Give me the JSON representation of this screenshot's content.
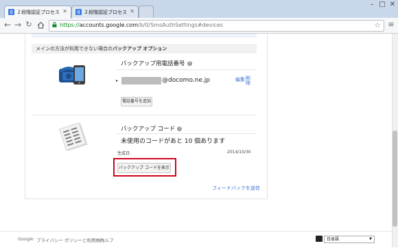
{
  "browser": {
    "tabs": [
      {
        "label": "２段階認証プロセス",
        "fav": "g"
      },
      {
        "label": "２段階認証プロセス",
        "fav": "g"
      }
    ],
    "url": {
      "scheme": "https://",
      "host": "accounts.google.com",
      "path": "/b/0/SmsAuthSettings#devices"
    }
  },
  "section": {
    "header_prefix": "メインの方法が利用できない場合の",
    "header_bold": "バックアップ オプション"
  },
  "phone": {
    "title": "バックアップ用電話番号",
    "email_suffix": "@docomo.ne.jp",
    "edit_label": "編集",
    "delete_label": "削除",
    "add_button": "電話番号を追加"
  },
  "codes": {
    "title": "バックアップ コード",
    "remaining": "未使用のコードがあと 10 個あります",
    "created_label": "生成日:",
    "created_date": "2014/10/30",
    "show_button": "バックアップ コードを表示"
  },
  "feedback_link": "フィードバックを送信",
  "footer": {
    "links": [
      "Google",
      "プライバシー ポリシーと利用規約",
      "ヘルプ"
    ],
    "language": "日本語"
  },
  "colors": {
    "highlight": "#d0021b",
    "link": "#3a6fd0"
  }
}
